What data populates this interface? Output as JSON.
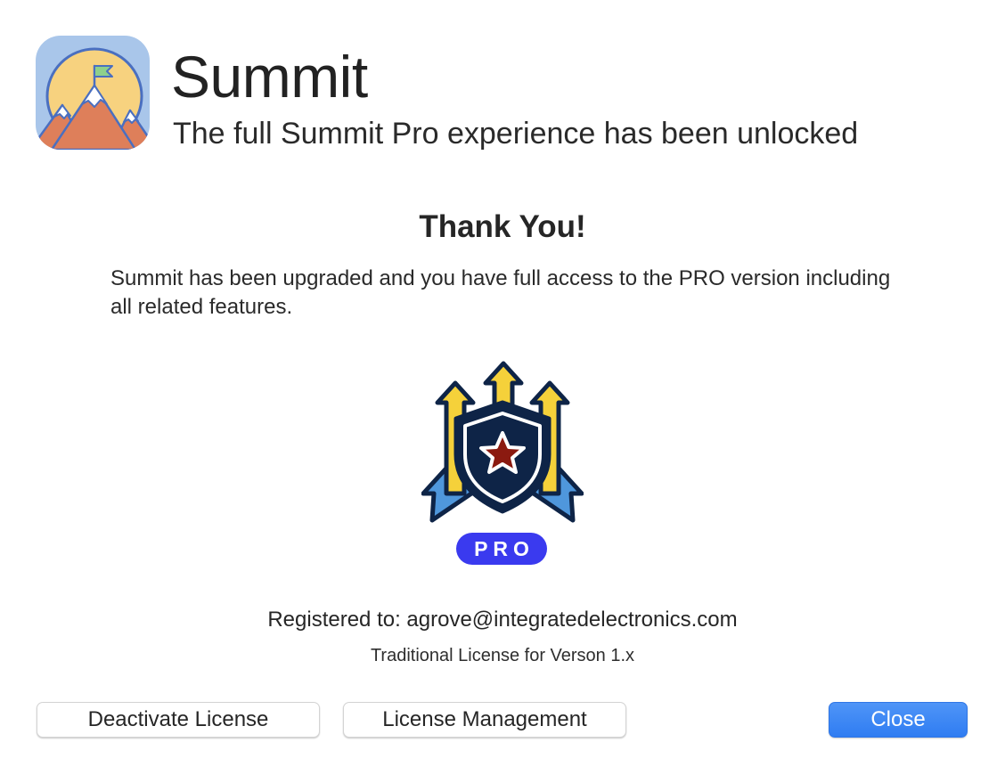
{
  "app": {
    "name": "Summit",
    "subtitle": "The full Summit Pro experience has been unlocked",
    "icon": "summit-mountain-flag-icon"
  },
  "content": {
    "heading": "Thank You!",
    "message": "Summit has been upgraded and you have full access to the PRO version including all related features.",
    "badge_icon": "pro-shield-star-arrows-icon",
    "badge_label": "PRO",
    "registered_to": "Registered to: agrove@integratedelectronics.com",
    "license_type": "Traditional License for Verson 1.x"
  },
  "buttons": {
    "deactivate": "Deactivate License",
    "manage": "License Management",
    "close": "Close"
  },
  "colors": {
    "primary_button": "#3a86f5",
    "pro_pill": "#3a3aef",
    "icon_sky": "#a9c6ea",
    "icon_sun": "#f7d27f",
    "icon_mountain": "#de7f5a",
    "badge_navy": "#0e2447",
    "badge_arrow_yellow": "#f5d13a",
    "badge_ribbon_blue": "#4f97dc",
    "badge_star_red": "#8b1a10"
  }
}
